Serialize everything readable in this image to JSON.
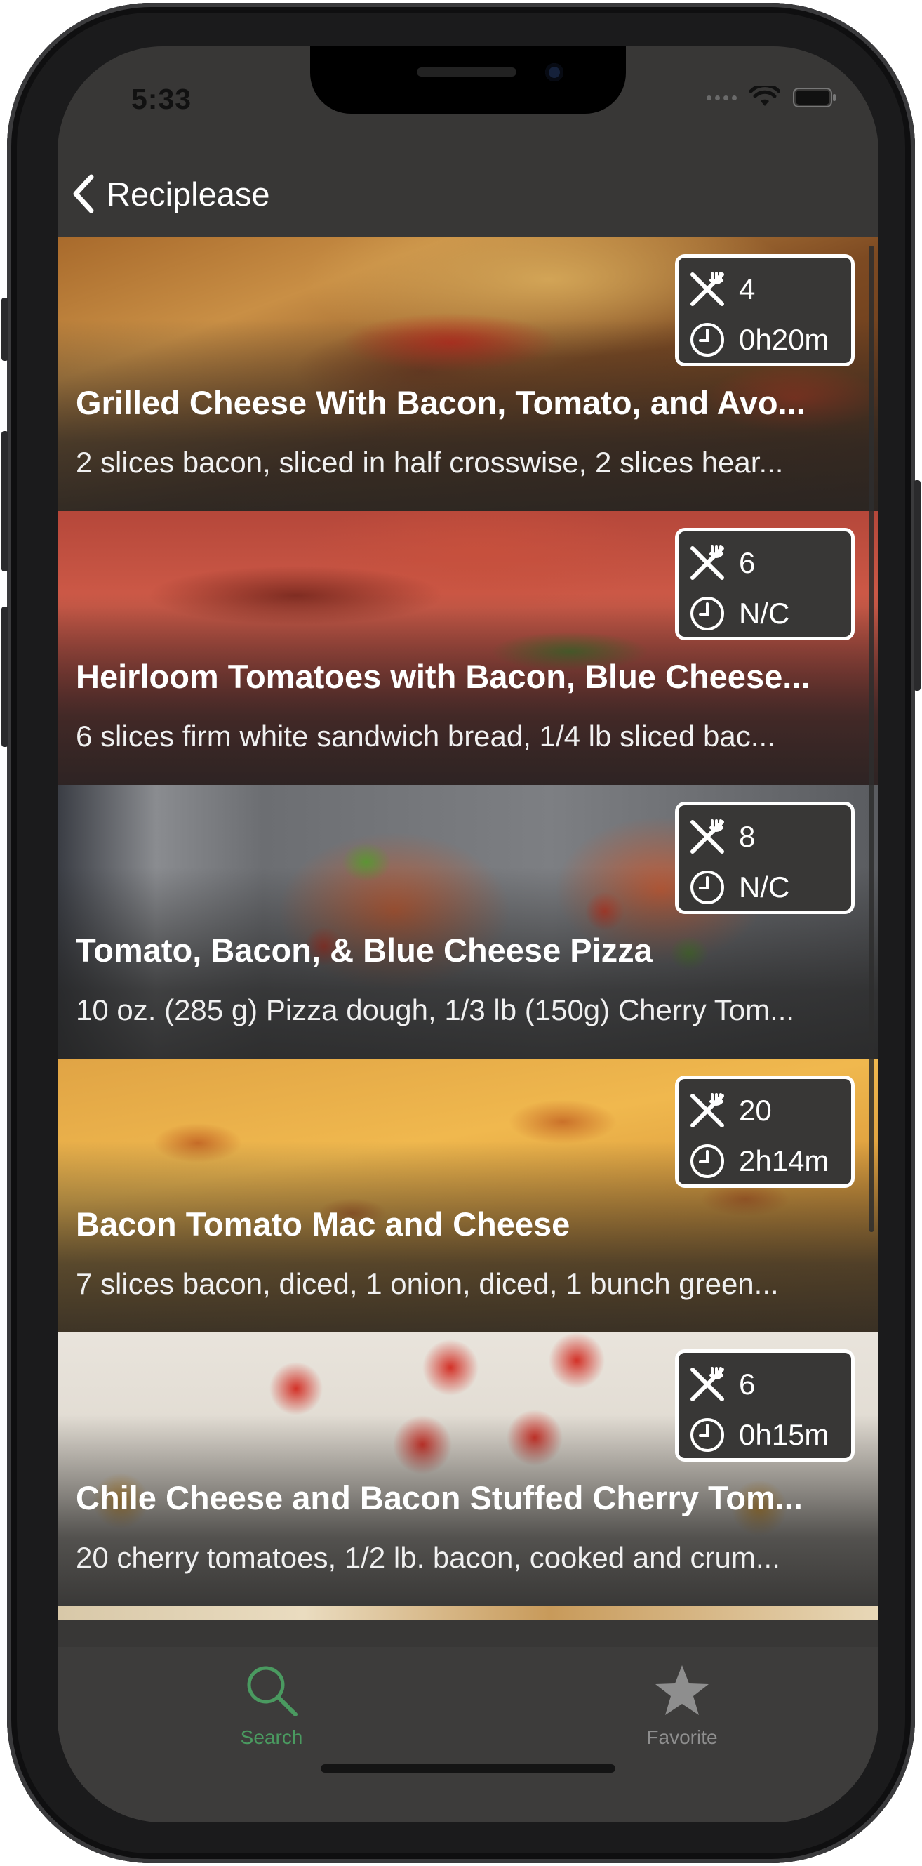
{
  "status_bar": {
    "time": "5:33"
  },
  "navbar": {
    "back_label": "Reciplease"
  },
  "recipes": [
    {
      "title": "Grilled Cheese With Bacon, Tomato, and Avo...",
      "ingredients": "2 slices bacon, sliced in half crosswise, 2 slices hear...",
      "servings": "4",
      "time": "0h20m"
    },
    {
      "title": "Heirloom Tomatoes with Bacon, Blue Cheese...",
      "ingredients": "6 slices firm white sandwich bread, 1/4 lb sliced bac...",
      "servings": "6",
      "time": "N/C"
    },
    {
      "title": "Tomato, Bacon, & Blue Cheese Pizza",
      "ingredients": "10 oz. (285 g) Pizza dough, 1/3 lb (150g) Cherry Tom...",
      "servings": "8",
      "time": "N/C"
    },
    {
      "title": "Bacon Tomato Mac and Cheese",
      "ingredients": "7 slices bacon, diced, 1 onion, diced, 1 bunch green...",
      "servings": "20",
      "time": "2h14m"
    },
    {
      "title": "Chile Cheese and Bacon Stuffed Cherry Tom...",
      "ingredients": "20 cherry tomatoes, 1/2 lb. bacon, cooked and crum...",
      "servings": "6",
      "time": "0h15m"
    }
  ],
  "tabs": [
    {
      "label": "Search",
      "icon": "search-icon",
      "selected": true
    },
    {
      "label": "Favorite",
      "icon": "star-icon",
      "selected": false
    }
  ],
  "colors": {
    "background": "#383736",
    "tab_selected": "#4a9a60",
    "tab_unselected": "#8e8e8e"
  }
}
